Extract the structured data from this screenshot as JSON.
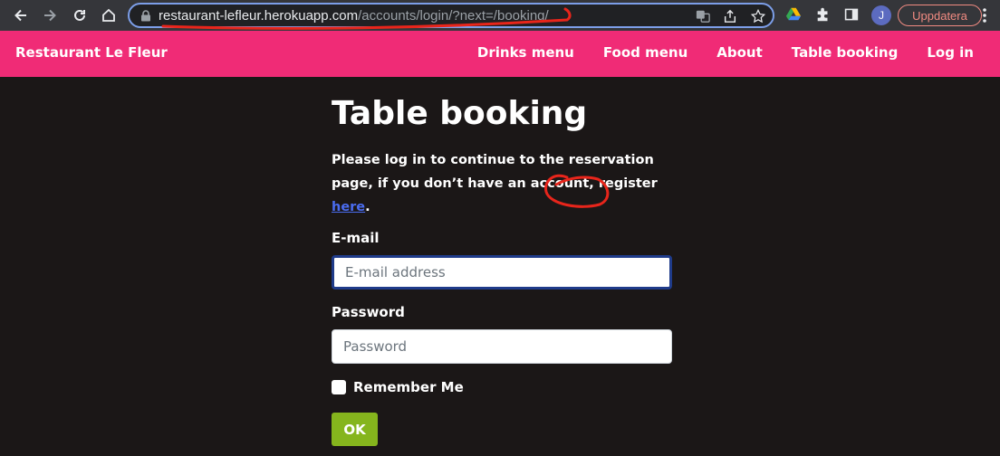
{
  "browser": {
    "url_host": "restaurant-lefleur.herokuapp.com",
    "url_path": "/accounts/login/?next=/booking/",
    "avatar_initial": "J",
    "update_label": "Uppdatera"
  },
  "nav": {
    "brand": "Restaurant Le Fleur",
    "links": [
      "Drinks menu",
      "Food menu",
      "About",
      "Table booking",
      "Log in"
    ]
  },
  "main": {
    "title": "Table booking",
    "intro_text": "Please log in to continue to the reservation page, if you don’t have an account, register ",
    "intro_link": "here",
    "intro_end": ".",
    "email_label": "E-mail",
    "email_placeholder": "E-mail address",
    "password_label": "Password",
    "password_placeholder": "Password",
    "remember_label": "Remember Me",
    "submit_label": "OK"
  },
  "colors": {
    "nav_bg": "#f02b76",
    "page_bg": "#1b1717",
    "button_bg": "#85b51d",
    "link": "#4a6cf0"
  }
}
